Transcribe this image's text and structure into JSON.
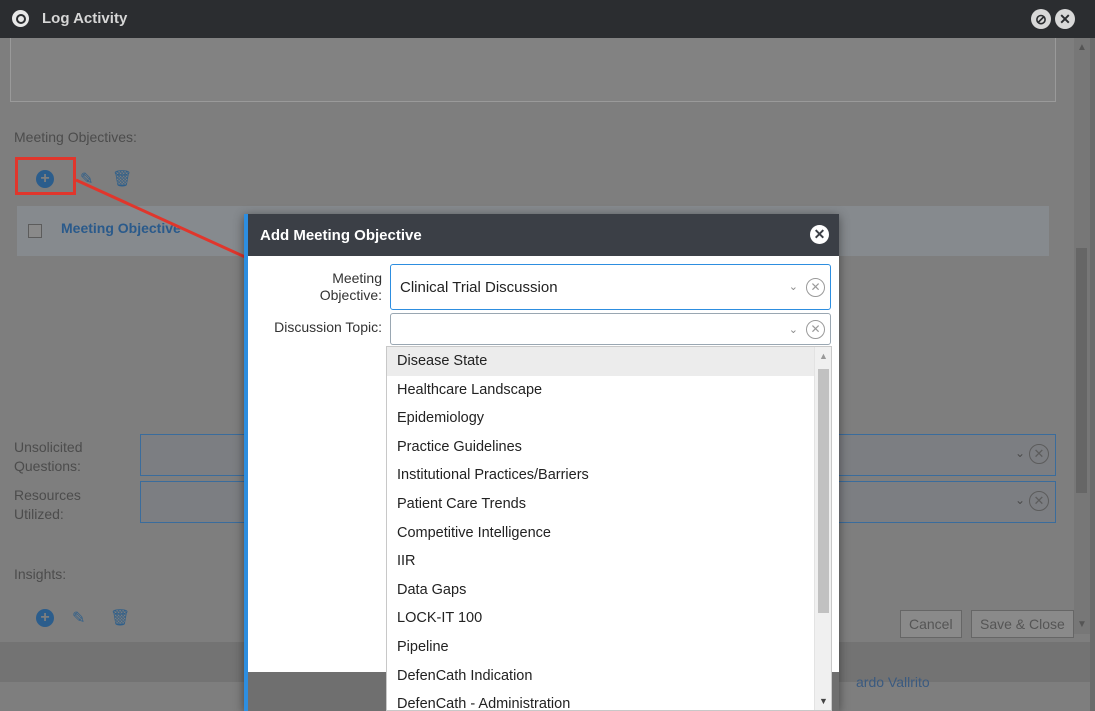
{
  "window": {
    "title": "Log Activity"
  },
  "background_form": {
    "meeting_objectives_label": "Meeting Objectives:",
    "table_header_label": "Meeting Objective",
    "unsolicited_questions_label": "Unsolicited Questions:",
    "resources_utilized_label": "Resources Utilized:",
    "insights_label": "Insights:",
    "cancel_label": "Cancel",
    "save_close_label": "Save & Close",
    "user_name_partial": "ardo Vallrito"
  },
  "modal": {
    "title": "Add Meeting Objective",
    "meeting_objective_label": "Meeting Objective:",
    "meeting_objective_value": "Clinical Trial Discussion",
    "discussion_topic_label": "Discussion Topic:",
    "discussion_topic_value": ""
  },
  "dropdown": {
    "options": [
      "Disease State",
      "Healthcare Landscape",
      "Epidemiology",
      "Practice Guidelines",
      "Institutional Practices/Barriers",
      "Patient Care Trends",
      "Competitive Intelligence",
      "IIR",
      "Data Gaps",
      "LOCK-IT 100",
      "Pipeline",
      "DefenCath Indication",
      "DefenCath - Administration"
    ],
    "highlighted": "Disease State"
  },
  "colors": {
    "accent": "#2d8ee0",
    "annotation_red": "#e0362c",
    "header_dark": "#3b3f46"
  }
}
